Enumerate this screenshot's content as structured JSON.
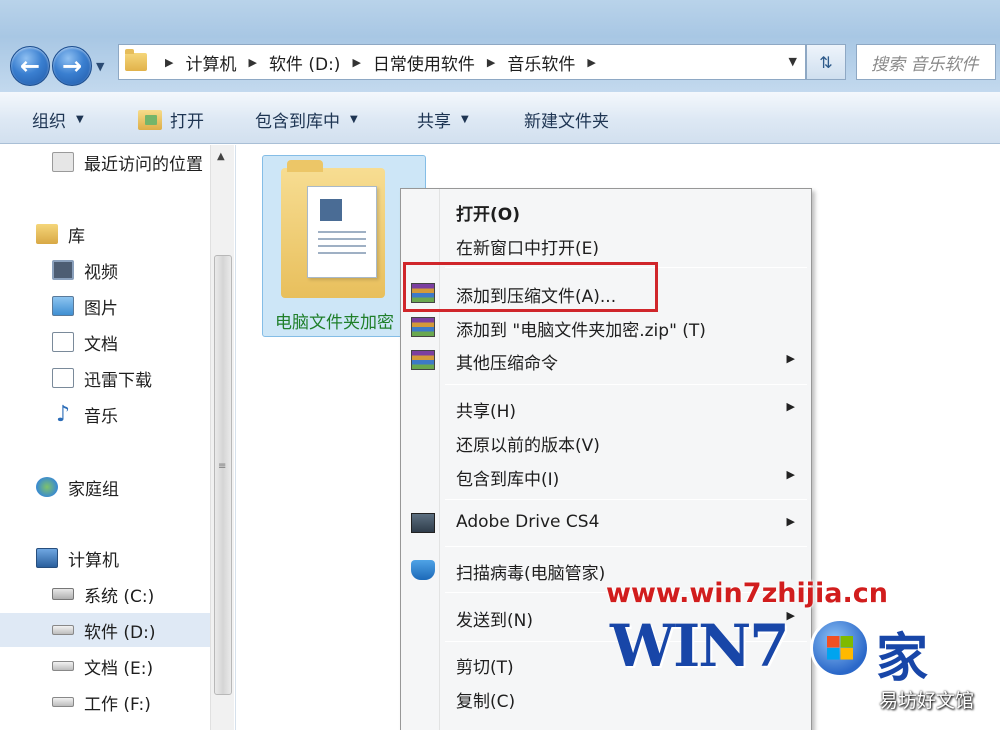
{
  "address": {
    "crumbs": [
      "计算机",
      "软件 (D:)",
      "日常使用软件",
      "音乐软件"
    ]
  },
  "search": {
    "placeholder": "搜索 音乐软件"
  },
  "toolbar": {
    "organize": "组织",
    "open": "打开",
    "include_library": "包含到库中",
    "share": "共享",
    "new_folder": "新建文件夹"
  },
  "nav": {
    "recent": "最近访问的位置",
    "library": "库",
    "videos": "视频",
    "pictures": "图片",
    "documents": "文档",
    "xunlei": "迅雷下载",
    "music": "音乐",
    "homegroup": "家庭组",
    "computer": "计算机",
    "drive_c": "系统 (C:)",
    "drive_d": "软件 (D:)",
    "drive_e": "文档 (E:)",
    "drive_f": "工作 (F:)"
  },
  "file": {
    "name": "电脑文件夹加密"
  },
  "context_menu": {
    "open": "打开(O)",
    "open_new_window": "在新窗口中打开(E)",
    "add_archive": "添加到压缩文件(A)...",
    "add_zip": "添加到 \"电脑文件夹加密.zip\" (T)",
    "other_compress": "其他压缩命令",
    "share": "共享(H)",
    "restore_prev": "还原以前的版本(V)",
    "include_library": "包含到库中(I)",
    "adobe_drive": "Adobe Drive CS4",
    "scan_virus": "扫描病毒(电脑管家)",
    "send_to": "发送到(N)",
    "cut": "剪切(T)",
    "copy": "复制(C)"
  },
  "watermark": {
    "url": "www.win7zhijia.cn",
    "win_text": "WIN7",
    "jia_text": "家",
    "site_name": "易坊好文馆"
  },
  "colors": {
    "highlight_box": "#d0262b",
    "watermark_url": "#d11d1d",
    "watermark_logo": "#1846a8",
    "file_name": "#1f7f2a"
  },
  "icons": {
    "back": "back-arrow-icon",
    "forward": "forward-arrow-icon",
    "refresh": "refresh-icon",
    "archive": "winrar-archive-icon",
    "shield": "security-shield-icon"
  }
}
